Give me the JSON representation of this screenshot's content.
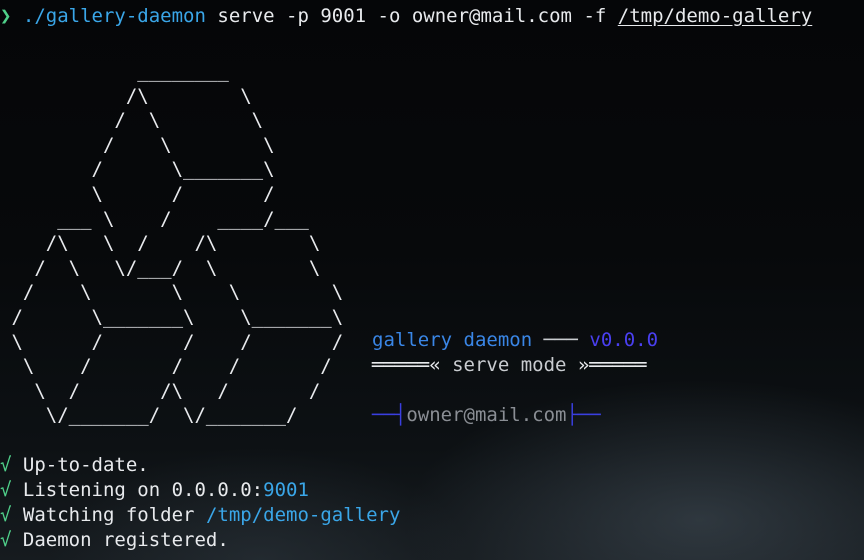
{
  "command": {
    "prompt": "❯",
    "executable": "./gallery-daemon",
    "args": "serve -p 9001 -o owner@mail.com -f",
    "folder": "/tmp/demo-gallery"
  },
  "ascii_logo": "            ________\n           /\\        \\\n          /  \\        \\\n         /    \\        \\\n        /      \\_______\\\n        \\      /       /\n     ___ \\    /    ____/___\n    /\\   \\  /    /\\        \\\n   /  \\   \\/___/  \\        \\\n  /    \\       \\    \\        \\\n /      \\_______\\    \\_______\\\n \\      /       /    /       /\n  \\    /       /    /       /\n   \\  /       /\\   /       /\n    \\/_______/  \\/_______/",
  "banner": {
    "app_name": "gallery daemon",
    "dash": "───",
    "version": "v0.0.0",
    "rule_left": "═════«",
    "mode": "serve mode",
    "rule_right": "»═════",
    "owner_left": "──┤",
    "owner": "owner@mail.com",
    "owner_right": "├──"
  },
  "status": {
    "check": "√",
    "uptodate": "Up-to-date.",
    "listening_prefix": "Listening on 0.0.0.0:",
    "port": "9001",
    "watching_prefix": "Watching folder ",
    "folder": "/tmp/demo-gallery",
    "registered": "Daemon registered."
  },
  "colors": {
    "prompt": "#4fd08a",
    "accent_cyan": "#3aa6e8",
    "accent_blue": "#3a86e6",
    "version_violet": "#4a3ff0",
    "check_green": "#4fd08a",
    "owner_gray": "#8a8e94"
  }
}
